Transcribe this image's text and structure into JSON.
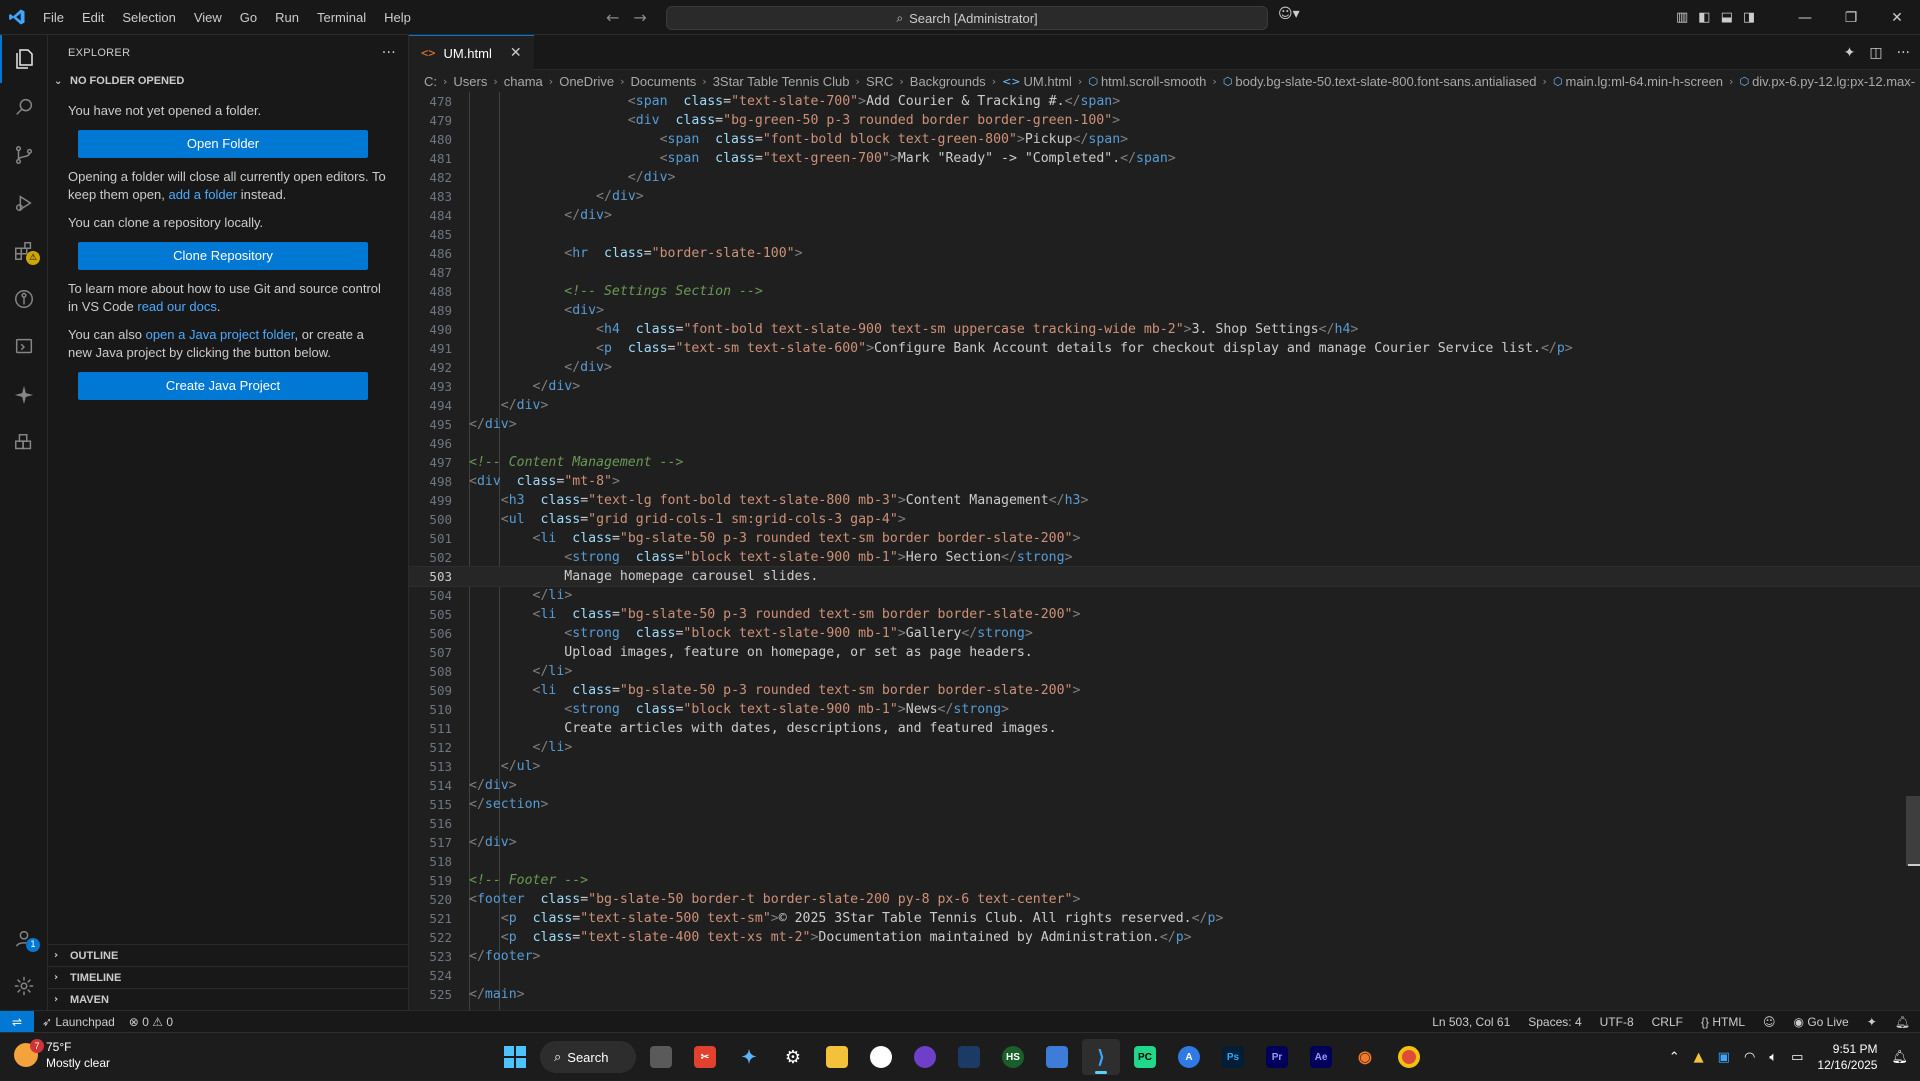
{
  "titlebar": {
    "menu": [
      "File",
      "Edit",
      "Selection",
      "View",
      "Go",
      "Run",
      "Terminal",
      "Help"
    ],
    "search_text": "Search [Administrator]"
  },
  "sidebar": {
    "header": "EXPLORER",
    "section_title": "NO FOLDER OPENED",
    "p1": "You have not yet opened a folder.",
    "open_folder_btn": "Open Folder",
    "p2_a": "Opening a folder will close all currently open editors. To keep them open, ",
    "p2_link": "add a folder",
    "p2_b": " instead.",
    "p3": "You can clone a repository locally.",
    "clone_btn": "Clone Repository",
    "p4_a": "To learn more about how to use Git and source control in VS Code ",
    "p4_link": "read our docs",
    "p4_b": ".",
    "p5_a": "You can also ",
    "p5_link": "open a Java project folder",
    "p5_b": ", or create a new Java project by clicking the button below.",
    "java_btn": "Create Java Project",
    "bottom_sections": [
      "OUTLINE",
      "TIMELINE",
      "MAVEN"
    ]
  },
  "editor": {
    "tab_label": "UM.html",
    "breadcrumb": [
      "C:",
      "Users",
      "chama",
      "OneDrive",
      "Documents",
      "3Star Table Tennis Club",
      "SRC",
      "Backgrounds",
      "UM.html",
      "html.scroll-smooth",
      "body.bg-slate-50.text-slate-800.font-sans.antialiased",
      "main.lg:ml-64.min-h-screen",
      "div.px-6.py-12.lg:px-12.max-"
    ],
    "current_line": 503
  },
  "code_lines": [
    {
      "n": "478",
      "t": "                    <span class=\"text-slate-700\">Add Courier & Tracking #.</span>"
    },
    {
      "n": "479",
      "t": "                    <div class=\"bg-green-50 p-3 rounded border border-green-100\">"
    },
    {
      "n": "480",
      "t": "                        <span class=\"font-bold block text-green-800\">Pickup</span>"
    },
    {
      "n": "481",
      "t": "                        <span class=\"text-green-700\">Mark \"Ready\" -> \"Completed\".</span>"
    },
    {
      "n": "482",
      "t": "                    </div>"
    },
    {
      "n": "483",
      "t": "                </div>"
    },
    {
      "n": "484",
      "t": "            </div>"
    },
    {
      "n": "485",
      "t": ""
    },
    {
      "n": "486",
      "t": "            <hr class=\"border-slate-100\">"
    },
    {
      "n": "487",
      "t": ""
    },
    {
      "n": "488",
      "t": "            <!-- Settings Section -->"
    },
    {
      "n": "489",
      "t": "            <div>"
    },
    {
      "n": "490",
      "t": "                <h4 class=\"font-bold text-slate-900 text-sm uppercase tracking-wide mb-2\">3. Shop Settings</h4>"
    },
    {
      "n": "491",
      "t": "                <p class=\"text-sm text-slate-600\">Configure Bank Account details for checkout display and manage Courier Service list.</p>"
    },
    {
      "n": "492",
      "t": "            </div>"
    },
    {
      "n": "493",
      "t": "        </div>"
    },
    {
      "n": "494",
      "t": "    </div>"
    },
    {
      "n": "495",
      "t": "</div>"
    },
    {
      "n": "496",
      "t": ""
    },
    {
      "n": "497",
      "t": "<!-- Content Management -->"
    },
    {
      "n": "498",
      "t": "<div class=\"mt-8\">"
    },
    {
      "n": "499",
      "t": "    <h3 class=\"text-lg font-bold text-slate-800 mb-3\">Content Management</h3>"
    },
    {
      "n": "500",
      "t": "    <ul class=\"grid grid-cols-1 sm:grid-cols-3 gap-4\">"
    },
    {
      "n": "501",
      "t": "        <li class=\"bg-slate-50 p-3 rounded text-sm border border-slate-200\">"
    },
    {
      "n": "502",
      "t": "            <strong class=\"block text-slate-900 mb-1\">Hero Section</strong>"
    },
    {
      "n": "503",
      "t": "            Manage homepage carousel slides."
    },
    {
      "n": "504",
      "t": "        </li>"
    },
    {
      "n": "505",
      "t": "        <li class=\"bg-slate-50 p-3 rounded text-sm border border-slate-200\">"
    },
    {
      "n": "506",
      "t": "            <strong class=\"block text-slate-900 mb-1\">Gallery</strong>"
    },
    {
      "n": "507",
      "t": "            Upload images, feature on homepage, or set as page headers."
    },
    {
      "n": "508",
      "t": "        </li>"
    },
    {
      "n": "509",
      "t": "        <li class=\"bg-slate-50 p-3 rounded text-sm border border-slate-200\">"
    },
    {
      "n": "510",
      "t": "            <strong class=\"block text-slate-900 mb-1\">News</strong>"
    },
    {
      "n": "511",
      "t": "            Create articles with dates, descriptions, and featured images."
    },
    {
      "n": "512",
      "t": "        </li>"
    },
    {
      "n": "513",
      "t": "    </ul>"
    },
    {
      "n": "514",
      "t": "</div>"
    },
    {
      "n": "515",
      "t": "</section>"
    },
    {
      "n": "516",
      "t": ""
    },
    {
      "n": "517",
      "t": "</div>"
    },
    {
      "n": "518",
      "t": ""
    },
    {
      "n": "519",
      "t": "<!-- Footer -->"
    },
    {
      "n": "520",
      "t": "<footer class=\"bg-slate-50 border-t border-slate-200 py-8 px-6 text-center\">"
    },
    {
      "n": "521",
      "t": "    <p class=\"text-slate-500 text-sm\">© 2025 3Star Table Tennis Club. All rights reserved.</p>"
    },
    {
      "n": "522",
      "t": "    <p class=\"text-slate-400 text-xs mt-2\">Documentation maintained by Administration.</p>"
    },
    {
      "n": "523",
      "t": "</footer>"
    },
    {
      "n": "524",
      "t": ""
    },
    {
      "n": "525",
      "t": "</main>"
    }
  ],
  "statusbar": {
    "launchpad": "Launchpad",
    "errors": "0",
    "warnings": "0",
    "position": "Ln 503, Col 61",
    "spaces": "Spaces: 4",
    "encoding": "UTF-8",
    "eol": "CRLF",
    "language": "HTML",
    "golive": "Go Live"
  },
  "taskbar": {
    "temperature": "75°F",
    "condition": "Mostly clear",
    "weather_badge": "7",
    "search_label": "Search",
    "time": "9:51 PM",
    "date": "12/16/2025"
  },
  "activity_badges": {
    "accounts": "1"
  },
  "colors": {
    "accent": "#0078d4",
    "tag": "#569cd6",
    "attr": "#9cdcfe",
    "string": "#ce9178",
    "comment": "#6a9955"
  }
}
